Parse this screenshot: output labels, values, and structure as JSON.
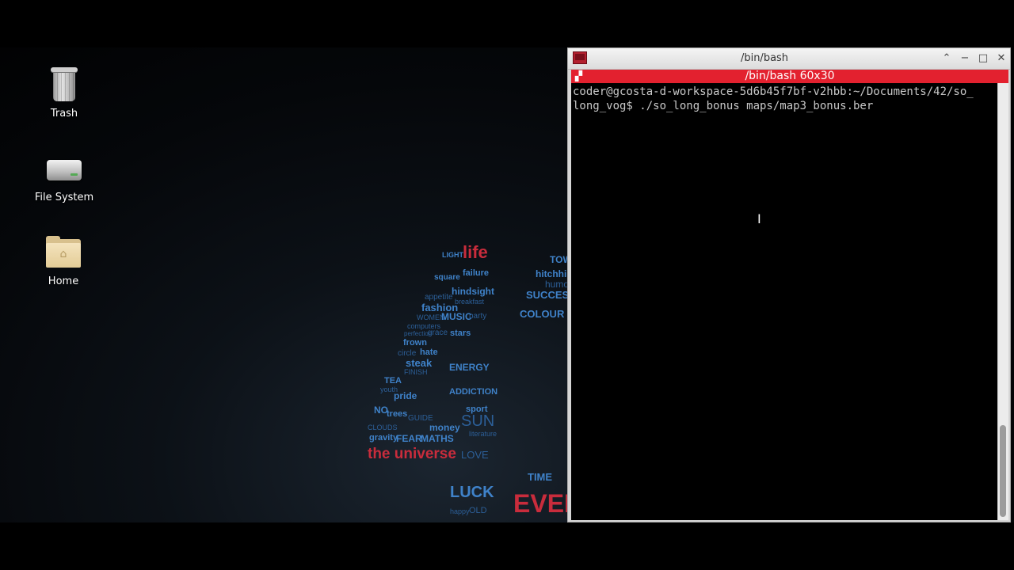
{
  "desktop": {
    "icons": [
      {
        "label": "Trash",
        "icon": "trash-icon"
      },
      {
        "label": "File System",
        "icon": "drive-icon"
      },
      {
        "label": "Home",
        "icon": "home-folder-icon"
      }
    ],
    "wallpaper_words": [
      "life",
      "LIGHT",
      "failure",
      "square",
      "hindsight",
      "appetite",
      "breakfast",
      "fashion",
      "WOMEN",
      "MUSIC",
      "party",
      "computers",
      "perfection",
      "grace",
      "stars",
      "frown",
      "circle",
      "hate",
      "steak",
      "FINISH",
      "ENERGY",
      "TEA",
      "youth",
      "pride",
      "ADDICTION",
      "NO",
      "trees",
      "GUIDE",
      "sport",
      "CLOUDS",
      "money",
      "gravity",
      "FEAR",
      "MATHS",
      "SUN",
      "literature",
      "the universe",
      "LOVE",
      "LUCK",
      "happy",
      "OLD",
      "EVER",
      "TOW",
      "hitchhik",
      "humo",
      "SUCCESS",
      "COLOUR",
      "TIME"
    ]
  },
  "terminal": {
    "window_title": "/bin/bash",
    "tab_title": "/bin/bash 60x30",
    "lines": [
      "coder@gcosta-d-workspace-5d6b45f7bf-v2hbb:~/Documents/42/so_",
      "long_vog$ ./so_long_bonus maps/map3_bonus.ber"
    ],
    "buttons": {
      "shade": "⌃",
      "minimize": "−",
      "maximize": "□",
      "close": "✕"
    }
  },
  "colors": {
    "tab_bar": "#e3212f",
    "wallpaper_blue": "#3f82c9",
    "wallpaper_red": "#c92c3c"
  }
}
